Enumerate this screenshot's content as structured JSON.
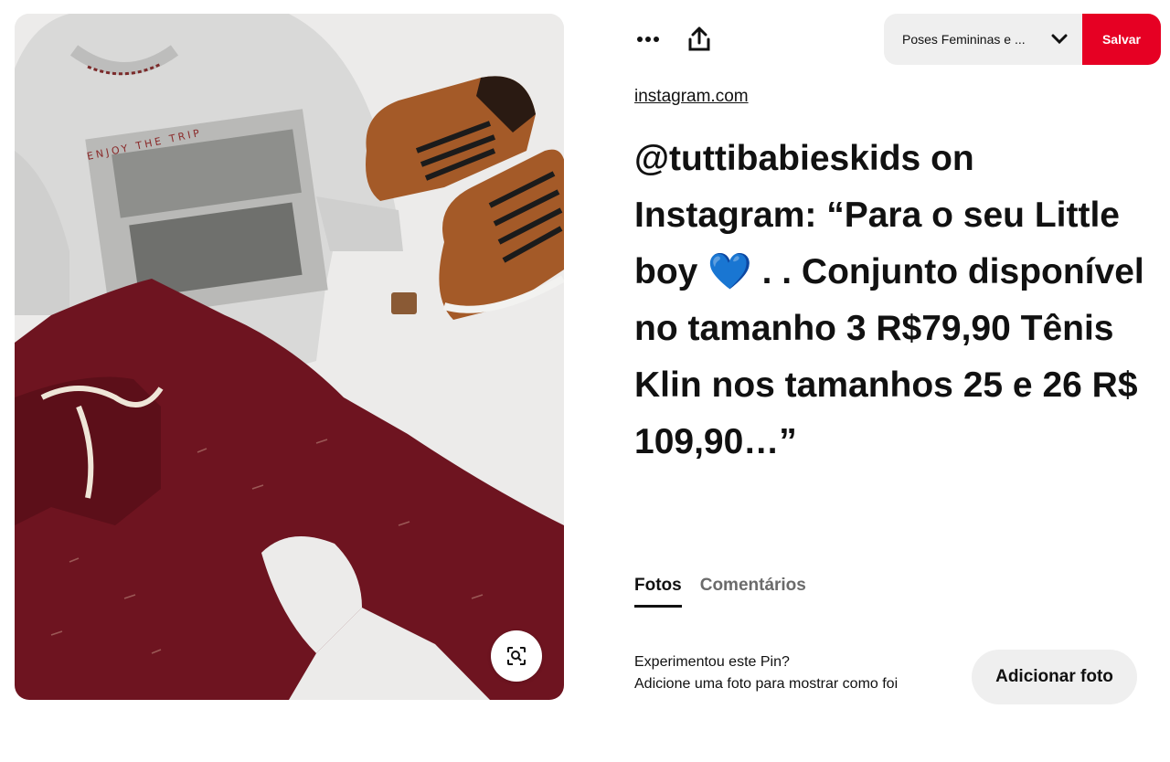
{
  "toolbar": {
    "more_icon": "more-horizontal-icon",
    "share_icon": "share-upload-icon"
  },
  "board_selector": {
    "selected": "Poses Femininas e ...",
    "icon": "chevron-down-icon"
  },
  "save_button": {
    "label": "Salvar",
    "color": "#e60023"
  },
  "pin": {
    "source": "instagram.com",
    "title_part1": "@tuttibabieskids on Instagram: “Para o seu Little boy ",
    "title_emoji": "💙",
    "title_part2": " . . Conjunto disponível no tamanho 3 R$79,90 Tênis Klin nos tamanhos 25 e 26 R$ 109,90…”"
  },
  "image": {
    "visual_search_icon": "visual-search-icon",
    "print_text": "ENJOY THE TRIP"
  },
  "tabs": [
    {
      "label": "Fotos",
      "active": true
    },
    {
      "label": "Comentários",
      "active": false
    }
  ],
  "try_pin": {
    "line1": "Experimentou este Pin?",
    "line2": "Adicione uma foto para mostrar como foi",
    "button_label": "Adicionar foto"
  }
}
